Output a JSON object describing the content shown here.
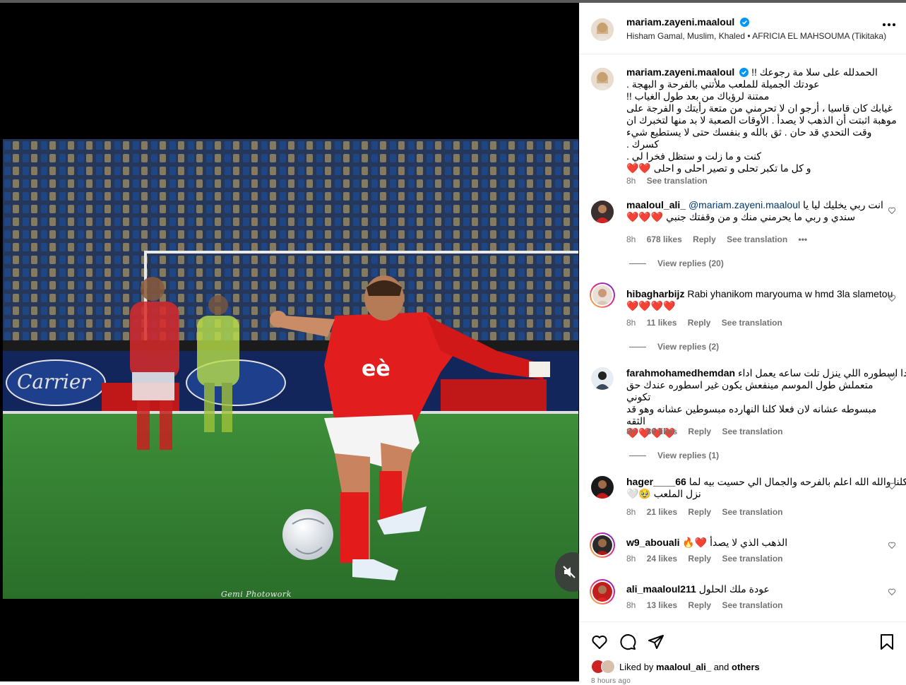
{
  "post": {
    "author": "mariam.zayeni.maaloul",
    "audio": "Hisham Gamal, Muslim, Khaled • AFRICIA EL MAHSOUMA (Tikitaka)",
    "photo_credit": "Gemi Photowork",
    "caption_lines": [
      "الحمدلله على سلا مة رجوعك !!",
      "عودتك الجميلة للملعب ملأتني بالفرحة و البهجة .",
      "ممتنة لرؤياك من بعد طول الغياب !!",
      "غيابك كان قاسيا ، أرجو ان لا تحرمني من متعة رأيتك و الفرجة على",
      "موهبة اثبتت أن الذهب لا يصدأ . الأوقات الصعبة لا بد منها لتخبرك ان",
      "وقت التحدي قد حان . ثق بالله و بنفسك حتى لا يستطيع شيء كسرك .",
      "كنت و ما زلت و ستظل فخرا لي .",
      "و كل ما تكبر تحلى و تصير احلى و احلى ❤️❤️"
    ],
    "caption_time": "8h",
    "see_translation": "See translation"
  },
  "comments": [
    {
      "user": "maaloul_ali_",
      "mention": "@mariam.zayeni.maaloul",
      "text": "انت ربي يخليك ليا يا",
      "text2": "سندي و ربي ما يحرمني منك و من وقفتك جنبي ❤️❤️❤️",
      "time": "8h",
      "likes": "678 likes",
      "reply": "Reply",
      "translate": "See translation",
      "more": "•••",
      "view_replies": "View replies (20)"
    },
    {
      "user": "hibagharbijz",
      "text": "Rabi yhanikom maryouma w hmd 3la slametou",
      "text2": "❤️❤️❤️❤️",
      "time": "8h",
      "likes": "11 likes",
      "reply": "Reply",
      "translate": "See translation",
      "view_replies": "View replies (2)"
    },
    {
      "user": "farahmohamedhemdan",
      "text": "دا اسطوره اللي ينزل تلت ساعه يعمل اداء",
      "text2": "متعملش طول الموسم مينفعش يكون غير اسطوره عندك حق تكوني",
      "text3": "مبسوطه عشانه لان فعلا كلنا النهارده مبسوطين عشانه وهو قد الثقه",
      "text4": "❤️❤️❤️❤️",
      "time": "8h",
      "likes": "89 likes",
      "reply": "Reply",
      "translate": "See translation",
      "view_replies": "View replies (1)"
    },
    {
      "user": "hager____66",
      "text": "كلنا والله الله اعلم بالفرحه والجمال الي حسيت بيه لما",
      "text2": "نزل الملعب 🥹🤍",
      "time": "8h",
      "likes": "21 likes",
      "reply": "Reply",
      "translate": "See translation"
    },
    {
      "user": "w9_abouali",
      "text": "الذهب الذي لا يصدأ ❤️🔥",
      "time": "8h",
      "likes": "24 likes",
      "reply": "Reply",
      "translate": "See translation"
    },
    {
      "user": "ali_maaloul211",
      "text": "عودة ملك الحلول",
      "time": "8h",
      "likes": "13 likes",
      "reply": "Reply",
      "translate": "See translation"
    }
  ],
  "footer": {
    "liked_by_prefix": "Liked by ",
    "liked_by_user": "maaloul_ali_",
    "liked_by_suffix": " and ",
    "others": "others",
    "posted_ago": "8 hours ago"
  },
  "colors": {
    "verified": "#0095f6",
    "meta": "#737373",
    "heart": "#e0112b"
  }
}
